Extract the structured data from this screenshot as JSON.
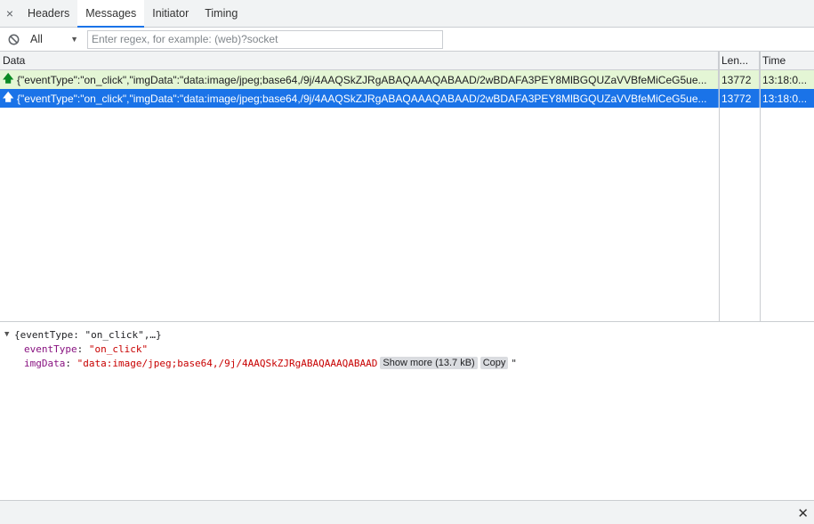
{
  "tabs": {
    "close_glyph": "×",
    "items": [
      {
        "label": "Headers",
        "active": false
      },
      {
        "label": "Messages",
        "active": true
      },
      {
        "label": "Initiator",
        "active": false
      },
      {
        "label": "Timing",
        "active": false
      }
    ]
  },
  "filter": {
    "select_value": "All",
    "input_placeholder": "Enter regex, for example: (web)?socket"
  },
  "table": {
    "columns": {
      "data": "Data",
      "length": "Len...",
      "time": "Time"
    },
    "rows": [
      {
        "direction": "sent",
        "data": "{\"eventType\":\"on_click\",\"imgData\":\"data:image/jpeg;base64,/9j/4AAQSkZJRgABAQAAAQABAAD/2wBDAFA3PEY8MlBGQUZaVVBfeMiCeG5ue...",
        "length": "13772",
        "time": "13:18:0..."
      },
      {
        "direction": "sent",
        "data": "{\"eventType\":\"on_click\",\"imgData\":\"data:image/jpeg;base64,/9j/4AAQSkZJRgABAQAAAQABAAD/2wBDAFA3PEY8MlBGQUZaVVBfeMiCeG5ue...",
        "length": "13772",
        "time": "13:18:0..."
      }
    ]
  },
  "detail": {
    "summary": "{eventType: \"on_click\",…}",
    "event_type_key": "eventType",
    "event_type_value": "\"on_click\"",
    "img_data_key": "imgData",
    "img_data_value": "\"data:image/jpeg;base64,/9j/4AAQSkZJRgABAQAAAQABAAD",
    "show_more_label": "Show more (13.7 kB)",
    "copy_label": "Copy",
    "closing_quote": "\""
  },
  "bottom": {
    "close_glyph": "✕"
  },
  "colors": {
    "accent": "#1a73e8",
    "sent_row": "#e4f6d5",
    "up_arrow": "#0a8a23"
  }
}
